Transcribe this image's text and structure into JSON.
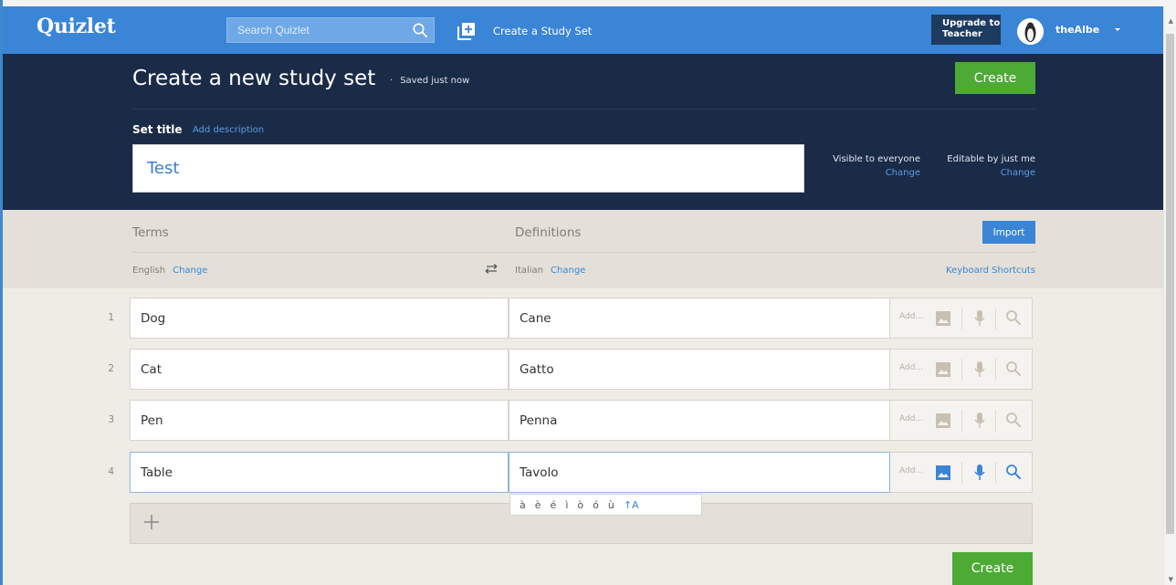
{
  "nav": {
    "logo": "Quizlet",
    "search_placeholder": "Search Quizlet",
    "create_label": "Create a Study Set",
    "upgrade_line1": "Upgrade to",
    "upgrade_line2": "Teacher",
    "username": "theAlbe"
  },
  "header": {
    "title": "Create a new study set",
    "saved_status": "Saved just now",
    "create_label": "Create",
    "set_title_label": "Set title",
    "add_description": "Add description",
    "title_value": "Test",
    "visibility_label": "Visible to everyone",
    "visibility_change": "Change",
    "editable_label": "Editable by just me",
    "editable_change": "Change"
  },
  "terms_header": {
    "terms_label": "Terms",
    "definitions_label": "Definitions",
    "import_label": "Import",
    "term_language": "English",
    "term_language_change": "Change",
    "def_language": "Italian",
    "def_language_change": "Change",
    "keyboard_shortcuts": "Keyboard Shortcuts"
  },
  "rows": [
    {
      "num": "1",
      "term": "Dog",
      "definition": "Cane",
      "add_label": "Add..."
    },
    {
      "num": "2",
      "term": "Cat",
      "definition": "Gatto",
      "add_label": "Add..."
    },
    {
      "num": "3",
      "term": "Pen",
      "definition": "Penna",
      "add_label": "Add..."
    },
    {
      "num": "4",
      "term": "Table",
      "definition": "Tavolo",
      "add_label": "Add..."
    }
  ],
  "accents": [
    "à",
    "è",
    "é",
    "ì",
    "ò",
    "ó",
    "ù"
  ],
  "accent_caps": "↑A",
  "footer": {
    "create_label": "Create"
  },
  "colors": {
    "nav_blue": "#3a85d5",
    "hero_navy": "#1a2b47",
    "create_green": "#4daa35",
    "link_blue": "#3a85d5",
    "tool_idle": "#c9bfb1",
    "tool_active": "#3a85d5"
  }
}
